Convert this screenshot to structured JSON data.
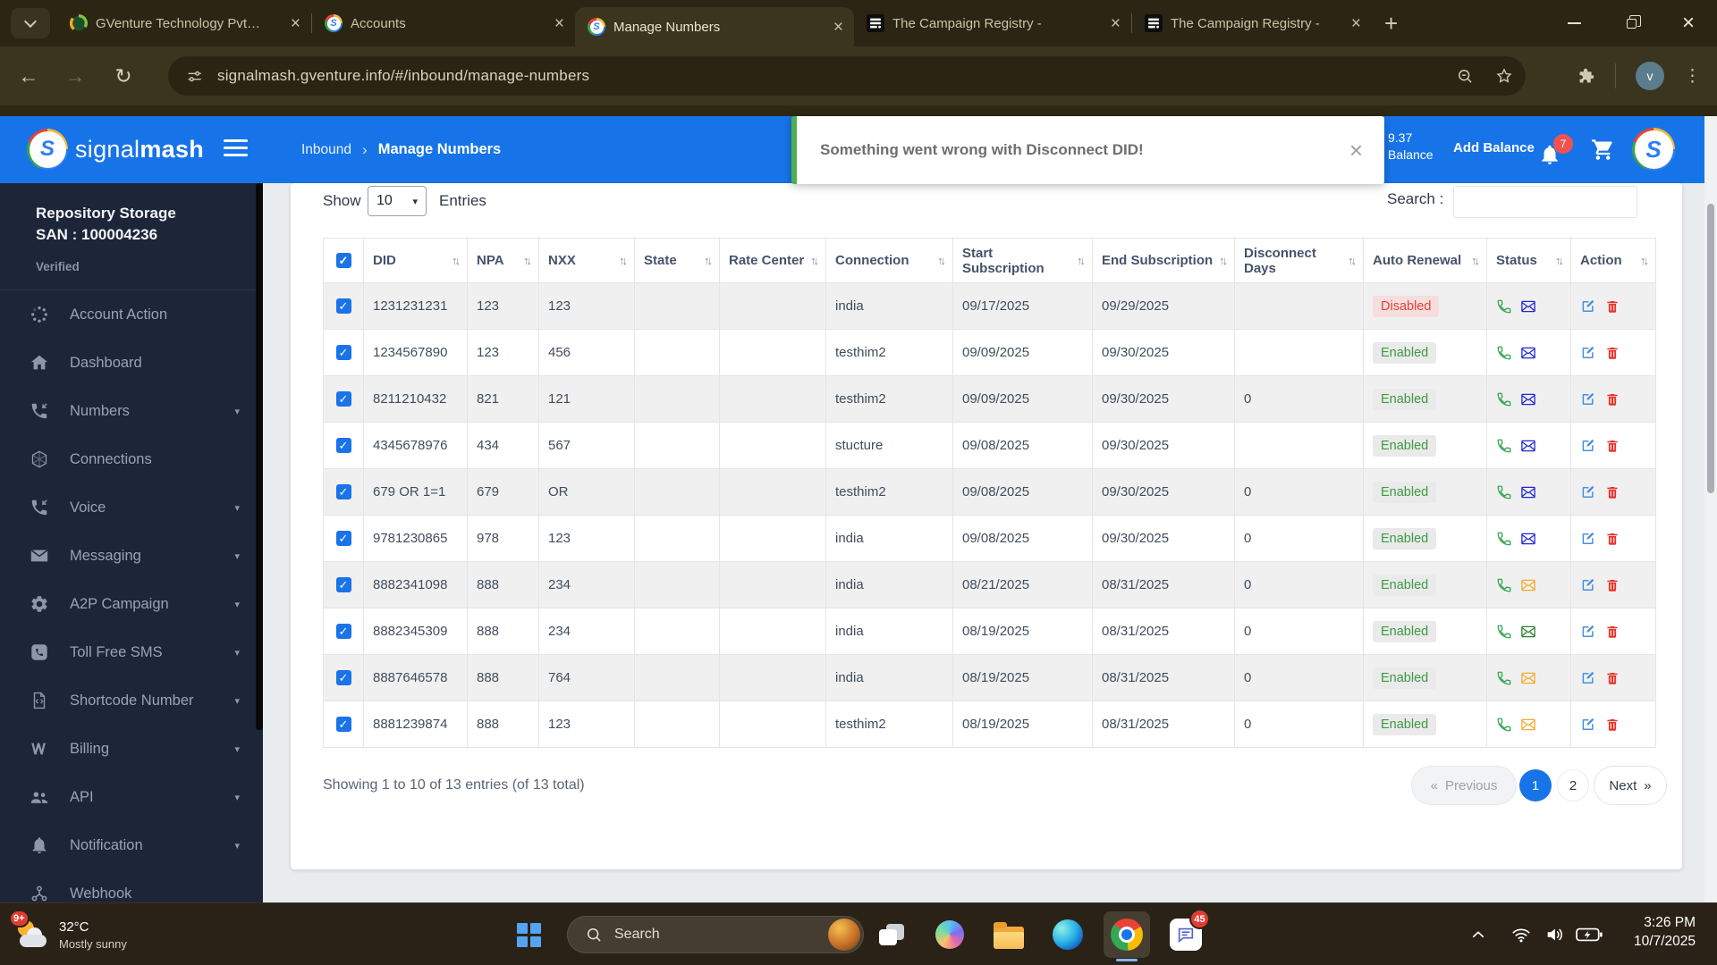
{
  "browser": {
    "tabs": [
      {
        "title": "GVenture Technology Pvt…",
        "icon": "gventure",
        "active": false
      },
      {
        "title": "Accounts",
        "icon": "signalmash",
        "active": false
      },
      {
        "title": "Manage Numbers",
        "icon": "signalmash",
        "active": true
      },
      {
        "title": "The Campaign Registry -",
        "icon": "registry",
        "active": false
      },
      {
        "title": "The Campaign Registry -",
        "icon": "registry",
        "active": false
      }
    ],
    "url": "signalmash.gventure.info/#/inbound/manage-numbers",
    "profile_initial": "v"
  },
  "header": {
    "brand_light": "signal",
    "brand_bold": "mash",
    "breadcrumb": [
      "Inbound",
      "Manage Numbers"
    ],
    "balance_amount": "9.37",
    "balance_label": "Balance",
    "add_balance_label": "Add Balance",
    "notification_count": "7"
  },
  "toast": {
    "message": "Something went wrong with Disconnect DID!"
  },
  "sidebar": {
    "storage_title": "Repository Storage",
    "storage_san": "SAN : 100004236",
    "verified_label": "Verified",
    "items": [
      {
        "label": "Account Action",
        "icon": "spinner-icon",
        "caret": false
      },
      {
        "label": "Dashboard",
        "icon": "home-icon",
        "caret": false
      },
      {
        "label": "Numbers",
        "icon": "phone-incoming-icon",
        "caret": true
      },
      {
        "label": "Connections",
        "icon": "hexagon-icon",
        "caret": false
      },
      {
        "label": "Voice",
        "icon": "phone-incoming-icon",
        "caret": true
      },
      {
        "label": "Messaging",
        "icon": "envelope-icon",
        "caret": true
      },
      {
        "label": "A2P Campaign",
        "icon": "gear-icon",
        "caret": true
      },
      {
        "label": "Toll Free SMS",
        "icon": "phone-square-icon",
        "caret": true
      },
      {
        "label": "Shortcode Number",
        "icon": "code-doc-icon",
        "caret": true
      },
      {
        "label": "Billing",
        "icon": "billing-icon",
        "caret": true
      },
      {
        "label": "API",
        "icon": "users-icon",
        "caret": true
      },
      {
        "label": "Notification",
        "icon": "bell-icon",
        "caret": true
      },
      {
        "label": "Webhook",
        "icon": "webhook-icon",
        "caret": false
      }
    ]
  },
  "controls": {
    "show_label": "Show",
    "show_value": "10",
    "entries_label": "Entries",
    "search_label": "Search :",
    "search_value": ""
  },
  "table": {
    "columns": [
      "DID",
      "NPA",
      "NXX",
      "State",
      "Rate Center",
      "Connection",
      "Start Subscription",
      "End Subscription",
      "Disconnect Days",
      "Auto Renewal",
      "Status",
      "Action"
    ],
    "rows": [
      {
        "checked": true,
        "did": "1231231231",
        "npa": "123",
        "nxx": "123",
        "state": "",
        "rate_center": "",
        "connection": "india",
        "start_subscription": "09/17/2025",
        "end_subscription": "09/29/2025",
        "disconnect_days": "",
        "auto_renewal": "Disabled",
        "envelope_color": "#2026d2"
      },
      {
        "checked": true,
        "did": "1234567890",
        "npa": "123",
        "nxx": "456",
        "state": "",
        "rate_center": "",
        "connection": "testhim2",
        "start_subscription": "09/09/2025",
        "end_subscription": "09/30/2025",
        "disconnect_days": "",
        "auto_renewal": "Enabled",
        "envelope_color": "#2026d2"
      },
      {
        "checked": true,
        "did": "8211210432",
        "npa": "821",
        "nxx": "121",
        "state": "",
        "rate_center": "",
        "connection": "testhim2",
        "start_subscription": "09/09/2025",
        "end_subscription": "09/30/2025",
        "disconnect_days": "0",
        "auto_renewal": "Enabled",
        "envelope_color": "#2026d2"
      },
      {
        "checked": true,
        "did": "4345678976",
        "npa": "434",
        "nxx": "567",
        "state": "",
        "rate_center": "",
        "connection": "stucture",
        "start_subscription": "09/08/2025",
        "end_subscription": "09/30/2025",
        "disconnect_days": "",
        "auto_renewal": "Enabled",
        "envelope_color": "#2026d2"
      },
      {
        "checked": true,
        "did": "679 OR 1=1",
        "npa": "679",
        "nxx": "OR",
        "state": "",
        "rate_center": "",
        "connection": "testhim2",
        "start_subscription": "09/08/2025",
        "end_subscription": "09/30/2025",
        "disconnect_days": "0",
        "auto_renewal": "Enabled",
        "envelope_color": "#2026d2"
      },
      {
        "checked": true,
        "did": "9781230865",
        "npa": "978",
        "nxx": "123",
        "state": "",
        "rate_center": "",
        "connection": "india",
        "start_subscription": "09/08/2025",
        "end_subscription": "09/30/2025",
        "disconnect_days": "0",
        "auto_renewal": "Enabled",
        "envelope_color": "#2026d2"
      },
      {
        "checked": true,
        "did": "8882341098",
        "npa": "888",
        "nxx": "234",
        "state": "",
        "rate_center": "",
        "connection": "india",
        "start_subscription": "08/21/2025",
        "end_subscription": "08/31/2025",
        "disconnect_days": "0",
        "auto_renewal": "Enabled",
        "envelope_color": "#f0ad2e"
      },
      {
        "checked": true,
        "did": "8882345309",
        "npa": "888",
        "nxx": "234",
        "state": "",
        "rate_center": "",
        "connection": "india",
        "start_subscription": "08/19/2025",
        "end_subscription": "08/31/2025",
        "disconnect_days": "0",
        "auto_renewal": "Enabled",
        "envelope_color": "#2e7d32"
      },
      {
        "checked": true,
        "did": "8887646578",
        "npa": "888",
        "nxx": "764",
        "state": "",
        "rate_center": "",
        "connection": "india",
        "start_subscription": "08/19/2025",
        "end_subscription": "08/31/2025",
        "disconnect_days": "0",
        "auto_renewal": "Enabled",
        "envelope_color": "#f0ad2e"
      },
      {
        "checked": true,
        "did": "8881239874",
        "npa": "888",
        "nxx": "123",
        "state": "",
        "rate_center": "",
        "connection": "testhim2",
        "start_subscription": "08/19/2025",
        "end_subscription": "08/31/2025",
        "disconnect_days": "0",
        "auto_renewal": "Enabled",
        "envelope_color": "#f0ad2e"
      }
    ]
  },
  "footer": {
    "summary": "Showing 1 to 10 of 13 entries (of 13 total)",
    "prev_symbol": "«",
    "previous_label": "Previous",
    "pages": [
      "1",
      "2"
    ],
    "active_page": "1",
    "next_label": "Next",
    "next_symbol": "»"
  },
  "taskbar": {
    "weather_badge": "9+",
    "temperature": "32°C",
    "condition": "Mostly sunny",
    "search_label": "Search",
    "chat_badge": "45",
    "time": "3:26 PM",
    "date": "10/7/2025"
  },
  "colors": {
    "accent_blue": "#1774e8",
    "enabled_green": "#3d9a43",
    "disabled_red": "#e2403a",
    "toast_green": "#4caf50"
  }
}
